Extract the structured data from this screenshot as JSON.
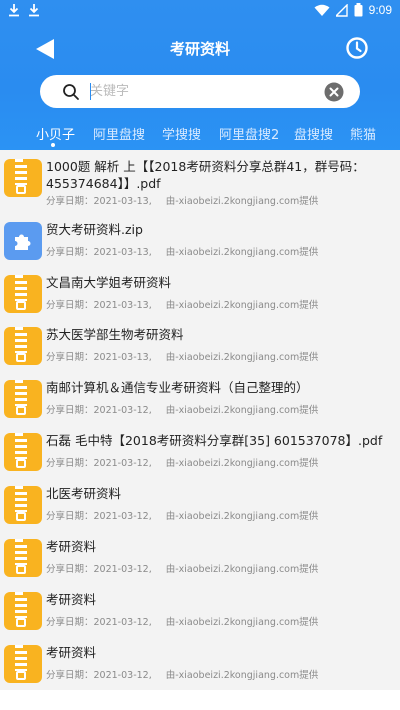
{
  "status_bar": {
    "time": "9:09",
    "icons": [
      "download-icon",
      "download-icon",
      "wifi-icon",
      "signal-icon",
      "battery-icon"
    ]
  },
  "header": {
    "title": "考研资料",
    "back_icon": "back-arrow-icon",
    "history_icon": "clock-icon"
  },
  "search": {
    "placeholder": "关键字",
    "value": "",
    "icon": "search-icon",
    "clear_icon": "clear-icon"
  },
  "tabs": [
    {
      "label": "小贝子",
      "active": true
    },
    {
      "label": "阿里盘搜",
      "active": false
    },
    {
      "label": "学搜搜",
      "active": false
    },
    {
      "label": "阿里盘搜2",
      "active": false
    },
    {
      "label": "盘搜搜",
      "active": false
    },
    {
      "label": "熊猫",
      "active": false
    }
  ],
  "colors": {
    "header_blue": "#2a8cf0",
    "zip_orange": "#f9b320",
    "plugin_blue": "#5b9bf0"
  },
  "results": [
    {
      "title": "1000题 解析 上【【2018考研资料分享总群41，群号码：455374684】】.pdf",
      "date": "分享日期：2021-03-13,",
      "source": "由-xiaobeizi.2kongjiang.com提供",
      "icon": "zip-icon"
    },
    {
      "title": "贸大考研资料.zip",
      "date": "分享日期：2021-03-13,",
      "source": "由-xiaobeizi.2kongjiang.com提供",
      "icon": "puzzle-icon"
    },
    {
      "title": "文昌南大学姐考研资料",
      "date": "分享日期：2021-03-13,",
      "source": "由-xiaobeizi.2kongjiang.com提供",
      "icon": "zip-icon"
    },
    {
      "title": "苏大医学部生物考研资料",
      "date": "分享日期：2021-03-13,",
      "source": "由-xiaobeizi.2kongjiang.com提供",
      "icon": "zip-icon"
    },
    {
      "title": "南邮计算机＆通信专业考研资料（自己整理的）",
      "date": "分享日期：2021-03-12,",
      "source": "由-xiaobeizi.2kongjiang.com提供",
      "icon": "zip-icon"
    },
    {
      "title": "石磊 毛中特【2018考研资料分享群[35] 601537078】.pdf",
      "date": "分享日期：2021-03-12,",
      "source": "由-xiaobeizi.2kongjiang.com提供",
      "icon": "zip-icon"
    },
    {
      "title": "北医考研资料",
      "date": "分享日期：2021-03-12,",
      "source": "由-xiaobeizi.2kongjiang.com提供",
      "icon": "zip-icon"
    },
    {
      "title": "考研资料",
      "date": "分享日期：2021-03-12,",
      "source": "由-xiaobeizi.2kongjiang.com提供",
      "icon": "zip-icon"
    },
    {
      "title": "考研资料",
      "date": "分享日期：2021-03-12,",
      "source": "由-xiaobeizi.2kongjiang.com提供",
      "icon": "zip-icon"
    },
    {
      "title": "考研资料",
      "date": "分享日期：2021-03-12,",
      "source": "由-xiaobeizi.2kongjiang.com提供",
      "icon": "zip-icon"
    }
  ]
}
